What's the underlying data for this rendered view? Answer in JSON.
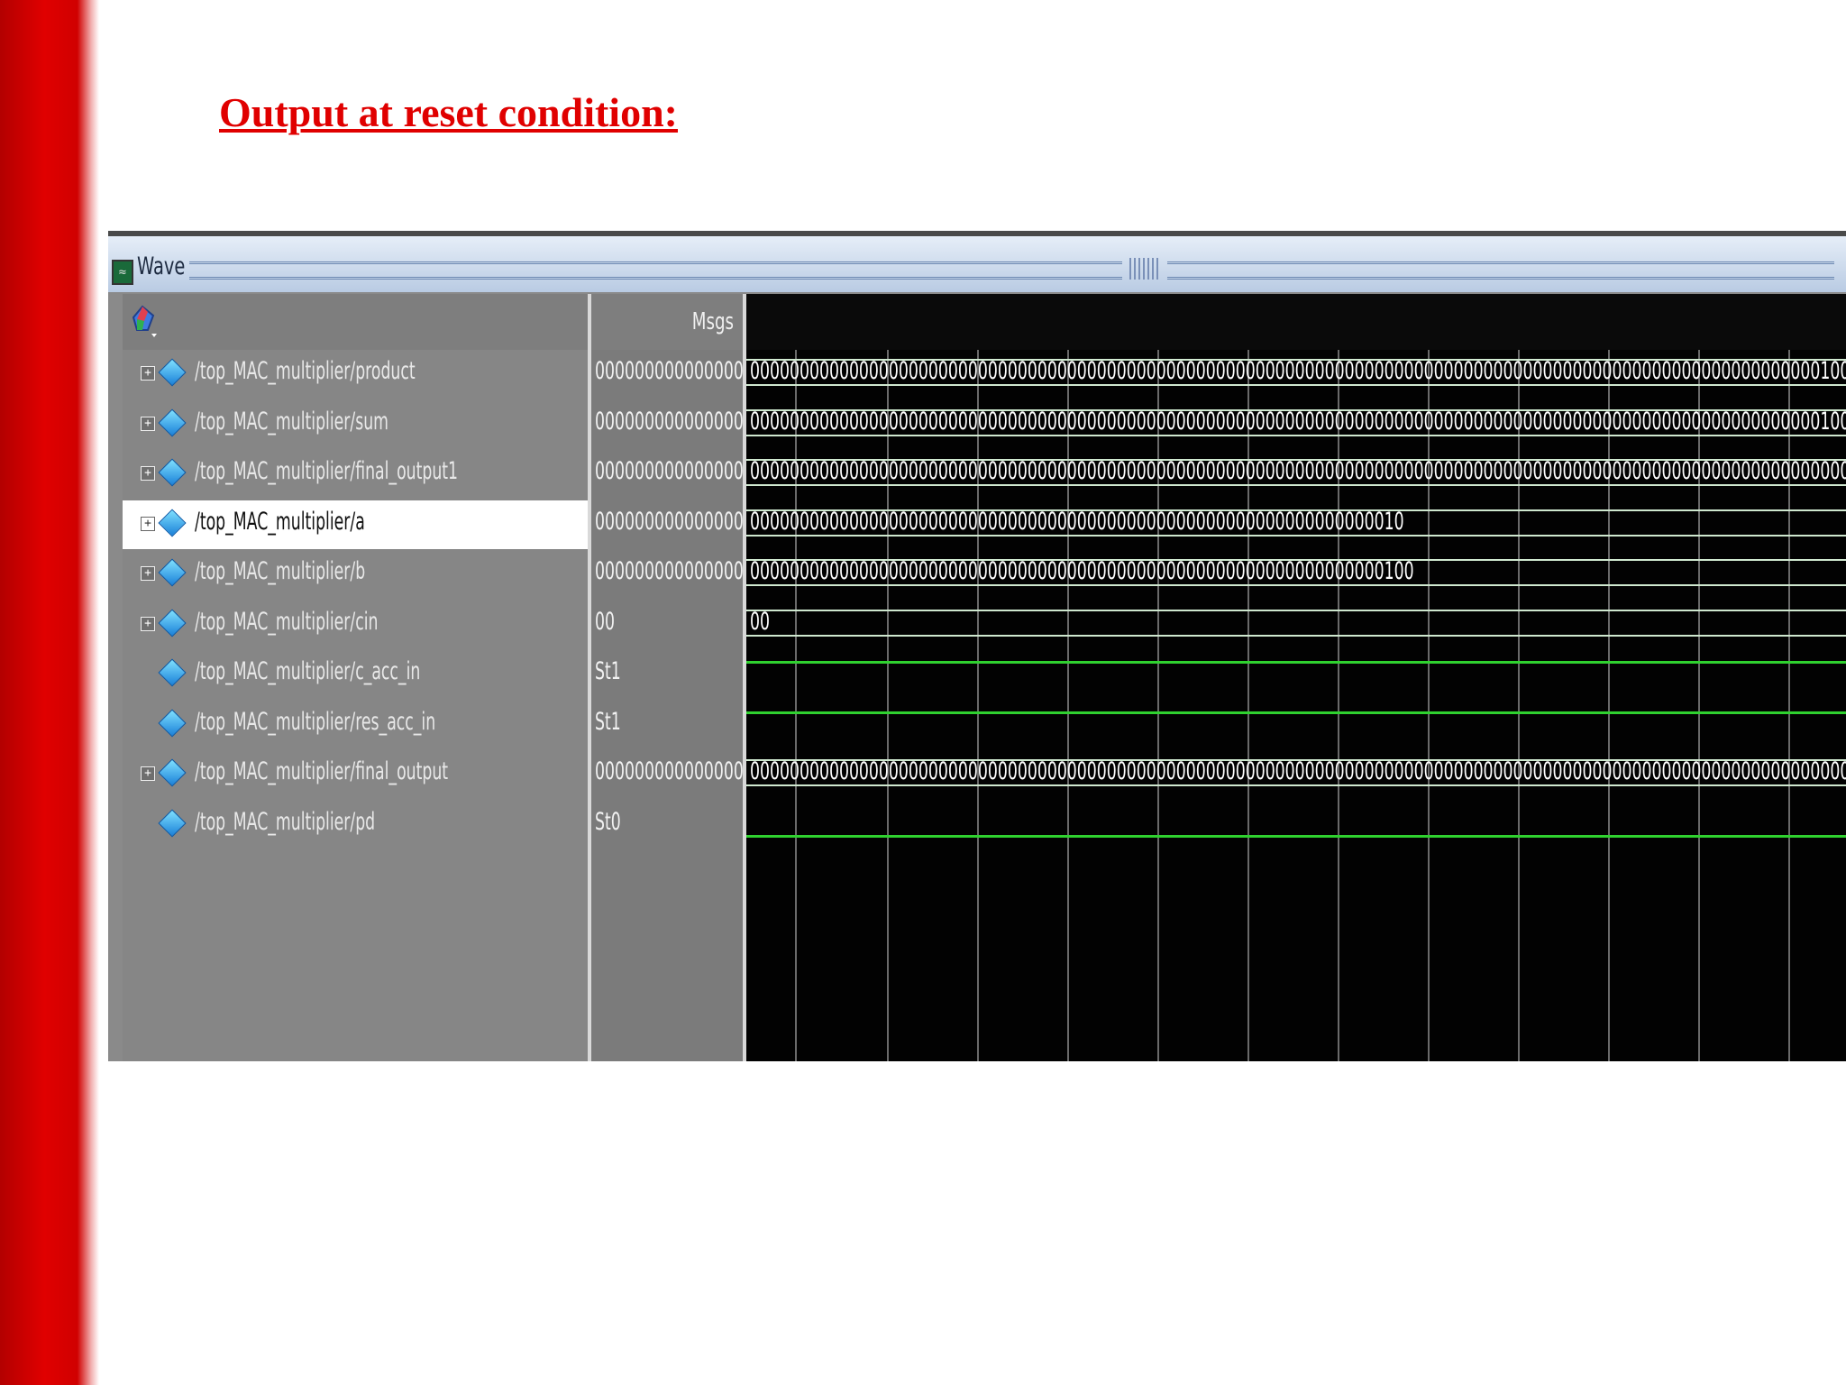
{
  "slide": {
    "title": "Output at reset condition:"
  },
  "window": {
    "title": "Wave"
  },
  "header": {
    "msgs_label": "Msgs"
  },
  "signals": [
    {
      "name": "/top_MAC_multiplier/product",
      "value": "0000000000000000(",
      "expandable": true,
      "kind": "bus",
      "wave_text": "0000000000000000000000000000000000000000000000000000000000000000000000000000000000000000000000000000000000001000"
    },
    {
      "name": "/top_MAC_multiplier/sum",
      "value": "0000000000000000(",
      "expandable": true,
      "kind": "bus",
      "wave_text": "0000000000000000000000000000000000000000000000000000000000000000000000000000000000000000000000000000000000001000"
    },
    {
      "name": "/top_MAC_multiplier/final_output1",
      "value": "0000000000000000(",
      "expandable": true,
      "kind": "bus",
      "wave_text": "00000000000000000000000000000000000000000000000000000000000000000000000000000000000000000000000000000000000000000"
    },
    {
      "name": "/top_MAC_multiplier/a",
      "value": "0000000000000000(",
      "expandable": true,
      "kind": "bus",
      "wave_text": "000000000000000000000000000000000000000000000000000000000000000010",
      "selected": true
    },
    {
      "name": "/top_MAC_multiplier/b",
      "value": "0000000000000000(",
      "expandable": true,
      "kind": "bus",
      "wave_text": "0000000000000000000000000000000000000000000000000000000000000000100"
    },
    {
      "name": "/top_MAC_multiplier/cin",
      "value": "00",
      "expandable": true,
      "kind": "bus",
      "wave_text": "00"
    },
    {
      "name": "/top_MAC_multiplier/c_acc_in",
      "value": "St1",
      "expandable": false,
      "kind": "bit",
      "level": 1
    },
    {
      "name": "/top_MAC_multiplier/res_acc_in",
      "value": "St1",
      "expandable": false,
      "kind": "bit",
      "level": 1
    },
    {
      "name": "/top_MAC_multiplier/final_output",
      "value": "0000000000000000(",
      "expandable": true,
      "kind": "bus",
      "wave_text": "00000000000000000000000000000000000000000000000000000000000000000000000000000000000000000000000000000000000000000"
    },
    {
      "name": "/top_MAC_multiplier/pd",
      "value": "St0",
      "expandable": false,
      "kind": "bit",
      "level": 0
    }
  ],
  "colors": {
    "accent_red": "#e00000",
    "wave_green": "#2fd12f",
    "cursor": "#e0c030"
  }
}
